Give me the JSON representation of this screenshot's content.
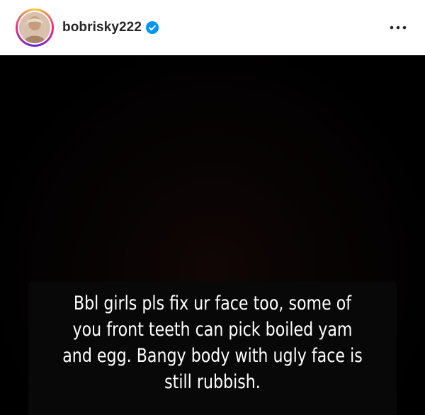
{
  "header": {
    "username": "bobrisky222",
    "verified": true,
    "verified_icon": "verified-badge-icon",
    "more_icon": "more-options-icon",
    "more_label": "•••",
    "avatar_ring_colors": [
      "#f9ce34",
      "#ee2a7b",
      "#6228d7"
    ]
  },
  "media": {
    "background_color": "#000000",
    "caption_lines": [
      "Bbl girls pls fix ur face too, some of",
      "you front teeth can pick boiled yam",
      "and egg. Bangy body with ugly face is",
      "still rubbish."
    ]
  },
  "colors": {
    "verified_blue": "#0095f6",
    "username_text": "#262626",
    "caption_text": "#ffffff"
  }
}
